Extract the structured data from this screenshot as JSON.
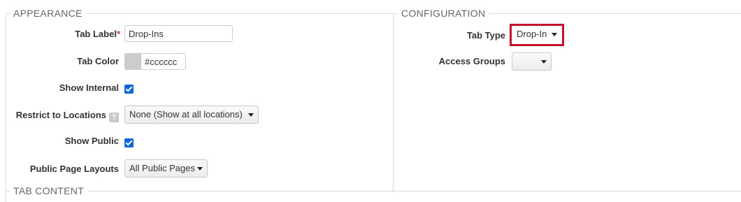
{
  "appearance": {
    "legend": "APPEARANCE",
    "tab_label": {
      "label": "Tab Label",
      "required_mark": "*",
      "value": "Drop-Ins"
    },
    "tab_color": {
      "label": "Tab Color",
      "swatch_color": "#cccccc",
      "value": "#cccccc"
    },
    "show_internal": {
      "label": "Show Internal",
      "checked": true
    },
    "restrict_locations": {
      "label": "Restrict to Locations",
      "help_glyph": "?",
      "selected": "None (Show at all locations)"
    },
    "show_public": {
      "label": "Show Public",
      "checked": true
    },
    "public_page_layouts": {
      "label": "Public Page Layouts",
      "selected": "All Public Pages"
    }
  },
  "configuration": {
    "legend": "CONFIGURATION",
    "tab_type": {
      "label": "Tab Type",
      "selected": "Drop-In",
      "highlighted": true
    },
    "access_groups": {
      "label": "Access Groups",
      "selected": ""
    }
  },
  "tab_content": {
    "legend": "TAB CONTENT"
  },
  "colors": {
    "highlight": "#c2112f",
    "checkbox": "#0a66d6",
    "required": "#c9302c"
  }
}
